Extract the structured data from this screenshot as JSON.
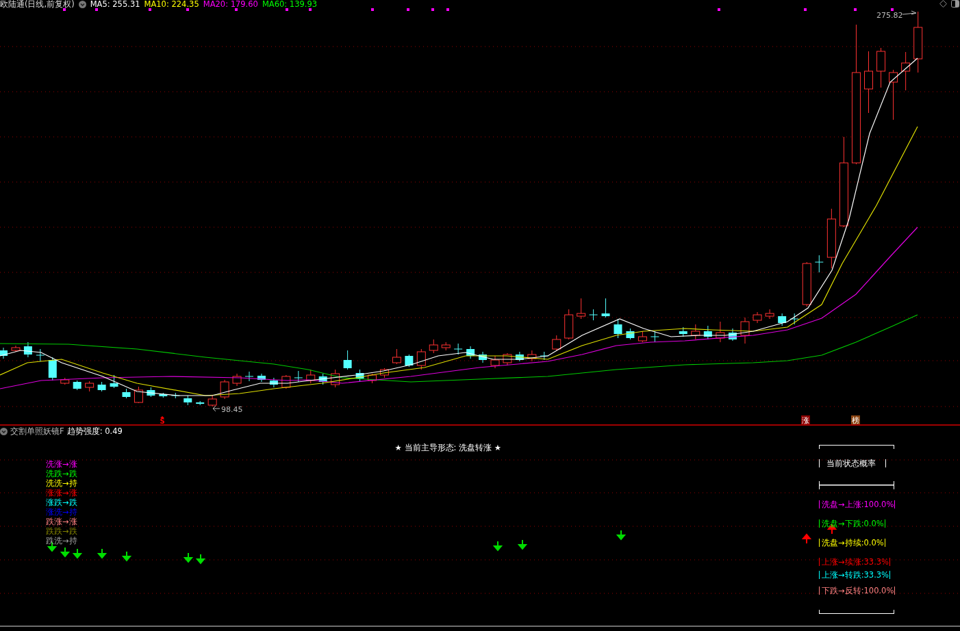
{
  "main_chart": {
    "title": "欧陆通(日线,前复权)",
    "ma_legend": [
      {
        "label": "MA5: 255.31",
        "color": "#ffffff"
      },
      {
        "label": "MA10: 224.35",
        "color": "#ffff00"
      },
      {
        "label": "MA20: 179.60",
        "color": "#ff00ff"
      },
      {
        "label": "MA60: 139.93",
        "color": "#00ff00"
      }
    ],
    "high_label": "275.82",
    "low_label": "98.45",
    "markers": [
      {
        "text": "S",
        "color": "#ff0000",
        "kind": "plain"
      },
      {
        "text": "涨",
        "color": "#8b0000",
        "kind": "boxed"
      },
      {
        "text": "榜",
        "color": "#8b4513",
        "kind": "boxed"
      }
    ]
  },
  "indicator": {
    "title": "交割单照妖镜F",
    "strength": "趋势强度: 0.49",
    "headline": "★ 当前主导形态: 洗盘转涨 ★",
    "legend": [
      {
        "text": "洗涨→涨",
        "color": "#ff00ff"
      },
      {
        "text": "洗跌→跌",
        "color": "#00ff00"
      },
      {
        "text": "洗洗→持",
        "color": "#ffff00"
      },
      {
        "text": "涨涨→涨",
        "color": "#ff0000"
      },
      {
        "text": "涨跌→跌",
        "color": "#00ffff"
      },
      {
        "text": "涨洗→持",
        "color": "#0000ff"
      },
      {
        "text": "跌涨→涨",
        "color": "#ff8080"
      },
      {
        "text": "跌跌→跌",
        "color": "#808000"
      },
      {
        "text": "跌洗→持",
        "color": "#a0a0a0"
      }
    ],
    "prob_title": "当前状态概率",
    "probs": [
      {
        "text": "洗盘→上涨:100.0%",
        "color": "#ff00ff"
      },
      {
        "text": "洗盘→下跌:0.0%",
        "color": "#00ff00"
      },
      {
        "text": "洗盘→持续:0.0%",
        "color": "#ffff00"
      },
      {
        "text": "上涨→续涨:33.3%",
        "color": "#ff0000"
      },
      {
        "text": "上涨→转跌:33.3%",
        "color": "#00ffff"
      },
      {
        "text": "下跌→反转:100.0%",
        "color": "#ff8080"
      }
    ]
  }
}
